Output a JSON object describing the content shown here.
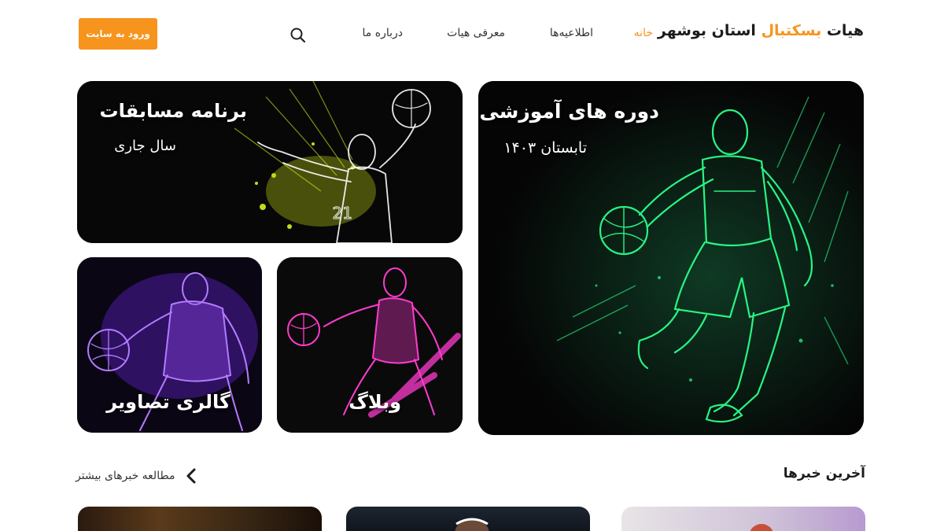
{
  "header": {
    "logo": {
      "part1": "هیات ",
      "accent": "بسکتبال",
      "part2": " استان بوشهر"
    },
    "nav": {
      "home": "خانه",
      "announcements": "اطلاعیه‌ها",
      "about_board": "معرفی هیات",
      "about_us": "درباره ما"
    },
    "login_label": "ورود به سایت"
  },
  "cards": {
    "main": {
      "title": "دوره های آموزشی",
      "subtitle": "تابستان ۱۴۰۳"
    },
    "competitions": {
      "title": "برنامه مسابقات",
      "subtitle": "سال جاری"
    },
    "blog": {
      "title": "وبلاگ"
    },
    "gallery": {
      "title": "گالری تصاویر"
    }
  },
  "news": {
    "title": "آخرین خبرها",
    "more_label": "مطالعه خبرهای بیشتر"
  },
  "colors": {
    "accent": "#f7941d",
    "neon_green": "#2bff8a",
    "neon_yellow": "#e6ff1a",
    "neon_pink": "#ff3bd0",
    "neon_purple": "#9b4dff"
  }
}
